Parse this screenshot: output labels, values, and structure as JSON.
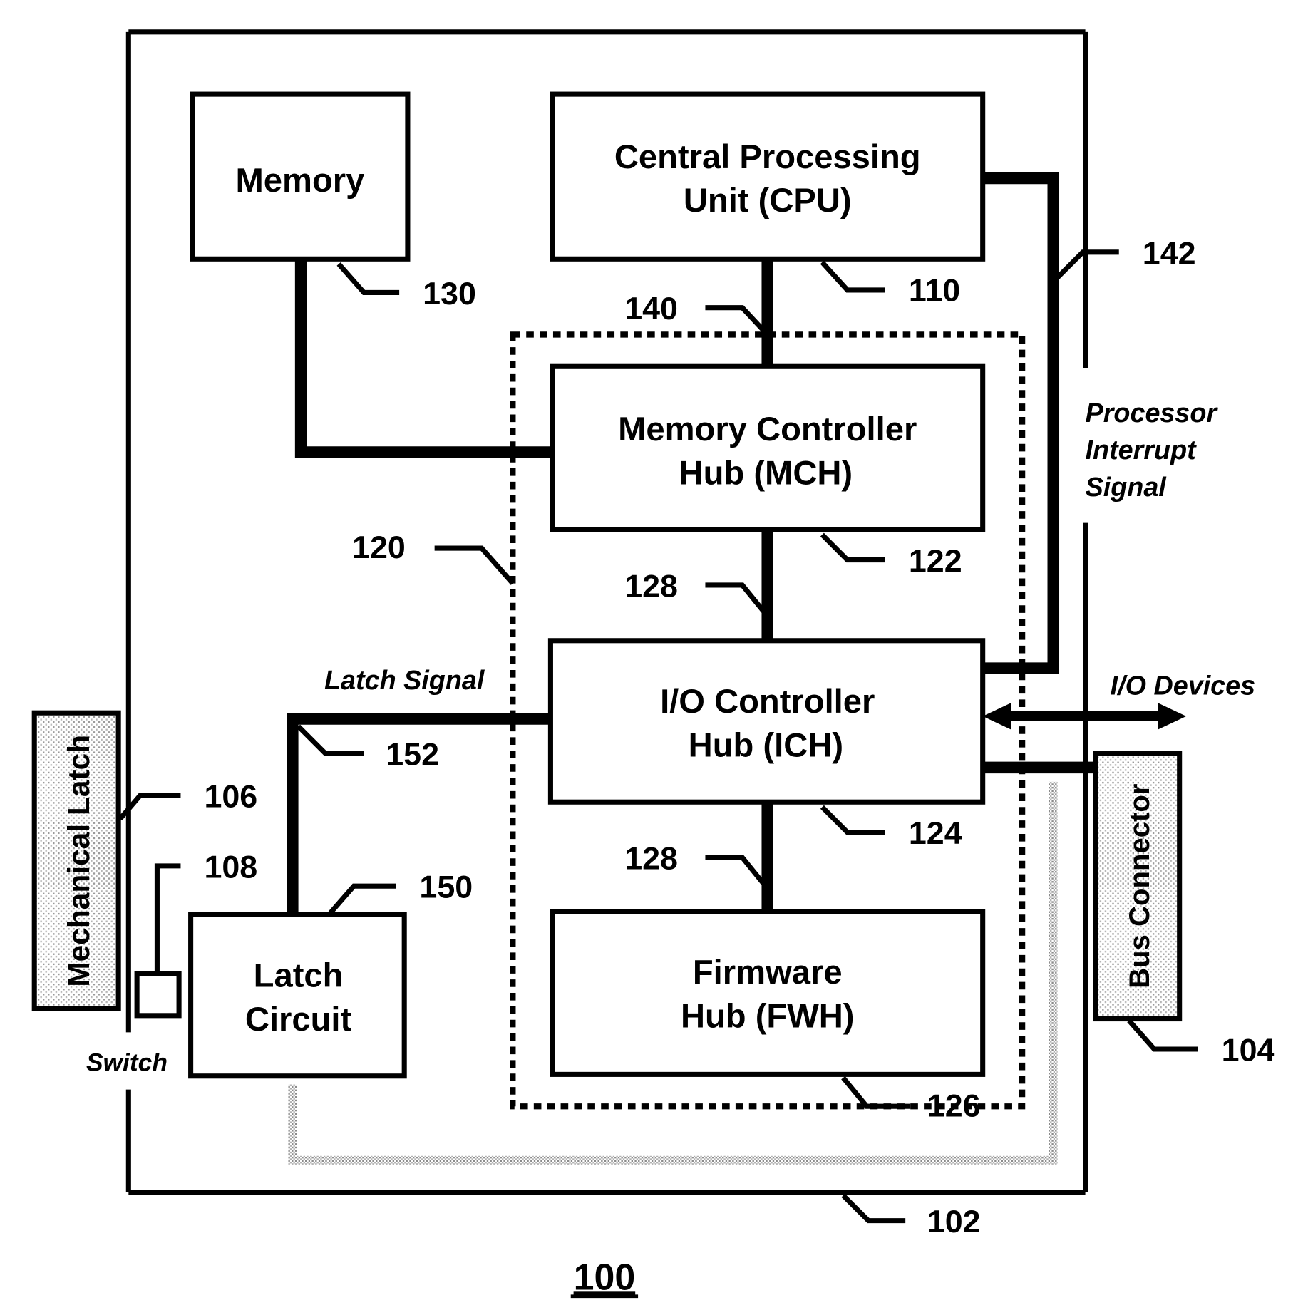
{
  "figure": {
    "number": "100",
    "board_ref": "102"
  },
  "blocks": {
    "memory": {
      "label_lines": [
        "Memory"
      ],
      "ref": "130"
    },
    "cpu": {
      "label_lines": [
        "Central Processing",
        "Unit (CPU)"
      ],
      "ref": "110"
    },
    "mch": {
      "label_lines": [
        "Memory Controller",
        "Hub (MCH)"
      ],
      "ref": "122"
    },
    "ich": {
      "label_lines": [
        "I/O Controller",
        "Hub (ICH)"
      ],
      "ref": "124"
    },
    "fwh": {
      "label_lines": [
        "Firmware",
        "Hub (FWH)"
      ],
      "ref": "126"
    },
    "latch_circuit": {
      "label_lines": [
        "Latch",
        "Circuit"
      ],
      "ref": "150"
    },
    "mechanical_latch": {
      "label": "Mechanical Latch",
      "ref": "106"
    },
    "bus_connector": {
      "label": "Bus Connector",
      "ref": "104"
    },
    "switch": {
      "label": "Switch",
      "ref": "108"
    }
  },
  "chipset": {
    "ref": "120"
  },
  "connections": {
    "cpu_mch_bus": {
      "ref": "140"
    },
    "mch_ich_bus": {
      "ref": "128"
    },
    "ich_fwh_bus": {
      "ref": "128"
    },
    "interrupt": {
      "ref": "142",
      "label_lines": [
        "Processor",
        "Interrupt",
        "Signal"
      ]
    },
    "latch_signal": {
      "ref": "152",
      "label": "Latch Signal"
    },
    "io_devices": {
      "label": "I/O Devices"
    }
  }
}
